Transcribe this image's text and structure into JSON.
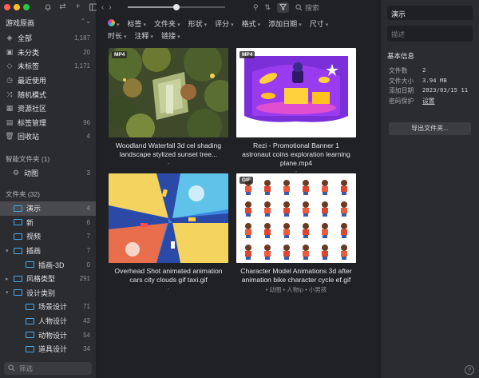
{
  "sidebar": {
    "library": "游戏原画",
    "nav": [
      {
        "label": "全部",
        "count": "1,187",
        "icon": "layers"
      },
      {
        "label": "未分类",
        "count": "20",
        "icon": "box"
      },
      {
        "label": "未标签",
        "count": "1,171",
        "icon": "tag"
      },
      {
        "label": "最近使用",
        "count": "",
        "icon": "clock"
      },
      {
        "label": "随机模式",
        "count": "",
        "icon": "shuffle"
      },
      {
        "label": "资源社区",
        "count": "",
        "icon": "grid"
      },
      {
        "label": "标签管理",
        "count": "96",
        "icon": "tags"
      },
      {
        "label": "回收站",
        "count": "4",
        "icon": "trash"
      }
    ],
    "smart_title": "智能文件夹 (1)",
    "smart": [
      {
        "label": "动图",
        "count": "3"
      }
    ],
    "folders_title": "文件夹 (32)",
    "folders": [
      {
        "label": "演示",
        "count": "4",
        "active": true,
        "child": false
      },
      {
        "label": "新",
        "count": "6",
        "active": false,
        "child": false
      },
      {
        "label": "视频",
        "count": "7",
        "active": false,
        "child": false
      },
      {
        "label": "插画",
        "count": "7",
        "active": false,
        "child": false
      },
      {
        "label": "插画-3D",
        "count": "0",
        "active": false,
        "child": true
      },
      {
        "label": "风格类型",
        "count": "291",
        "active": false,
        "child": false
      },
      {
        "label": "设计类别",
        "count": "",
        "active": false,
        "child": false
      },
      {
        "label": "场景设计",
        "count": "71",
        "active": false,
        "child": true
      },
      {
        "label": "人物设计",
        "count": "43",
        "active": false,
        "child": true
      },
      {
        "label": "动物设计",
        "count": "54",
        "active": false,
        "child": true
      },
      {
        "label": "道具设计",
        "count": "34",
        "active": false,
        "child": true
      }
    ],
    "filter_placeholder": "筛选"
  },
  "toolbar": {
    "search_placeholder": "搜索",
    "zoom_level": 0.5
  },
  "filters_row1": [
    "标签",
    "文件夹",
    "形状",
    "评分",
    "格式",
    "添加日期",
    "尺寸"
  ],
  "filters_row2": [
    "时长",
    "注释",
    "链接"
  ],
  "cards": [
    {
      "badge": "MP4",
      "title": "Woodland Waterfall 3d cel shading landscape stylized sunset tree...",
      "sub": "-"
    },
    {
      "badge": "MP4",
      "title": "Rezi - Promotional Banner 1 astronaut coins exploration learning plane.mp4",
      "sub": "-"
    },
    {
      "badge": "",
      "title": "Overhead Shot animated animation cars city clouds gif taxi.gif",
      "sub": "-"
    },
    {
      "badge": "GIF",
      "title": "Character Model Animations 3d after animation bike character cycle ef.gif",
      "sub": "• 动图 • 人物ip • 小男孩"
    }
  ],
  "inspector": {
    "title": "演示",
    "desc_placeholder": "描述",
    "section": "基本信息",
    "rows": [
      {
        "k": "文件数",
        "v": "2"
      },
      {
        "k": "文件大小",
        "v": "3.94 MB"
      },
      {
        "k": "添加日期",
        "v": "2023/03/15 11"
      },
      {
        "k": "密码保护",
        "v": "设置"
      }
    ],
    "export_label": "导出文件夹...",
    "help": "?"
  },
  "colors": {
    "accent": "#4aa8e8",
    "active_row": "#494a50"
  }
}
